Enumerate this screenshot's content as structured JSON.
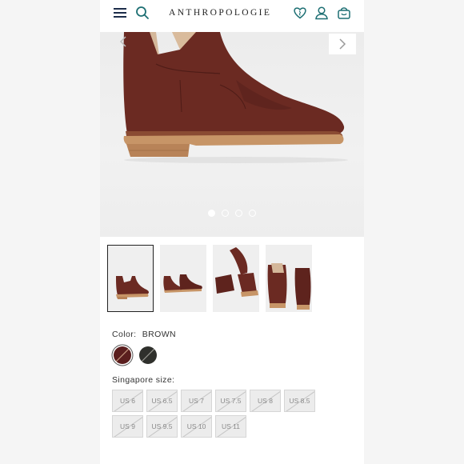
{
  "header": {
    "logo": "ANTHROPOLOGIE",
    "icons": [
      "menu-icon",
      "search-icon",
      "heart-icon",
      "user-icon",
      "bag-icon"
    ]
  },
  "hero": {
    "dots_total": 4,
    "active_dot": 1
  },
  "thumbnails": {
    "count": 4,
    "selected_index": 1
  },
  "color": {
    "label": "Color:",
    "value": "BROWN",
    "swatches": [
      {
        "name": "brown",
        "hex": "#5a1e1e"
      },
      {
        "name": "black",
        "hex": "#2f302c"
      }
    ]
  },
  "size": {
    "label": "Singapore size:",
    "options": [
      "US 6",
      "US 6.5",
      "US 7",
      "US 7.5",
      "US 8",
      "US 8.5",
      "US 9",
      "US 9.5",
      "US 10",
      "US 11"
    ]
  },
  "colors": {
    "brand_icon": "#1d6f73",
    "suede": "#6b2a22",
    "sole": "#c79567"
  }
}
